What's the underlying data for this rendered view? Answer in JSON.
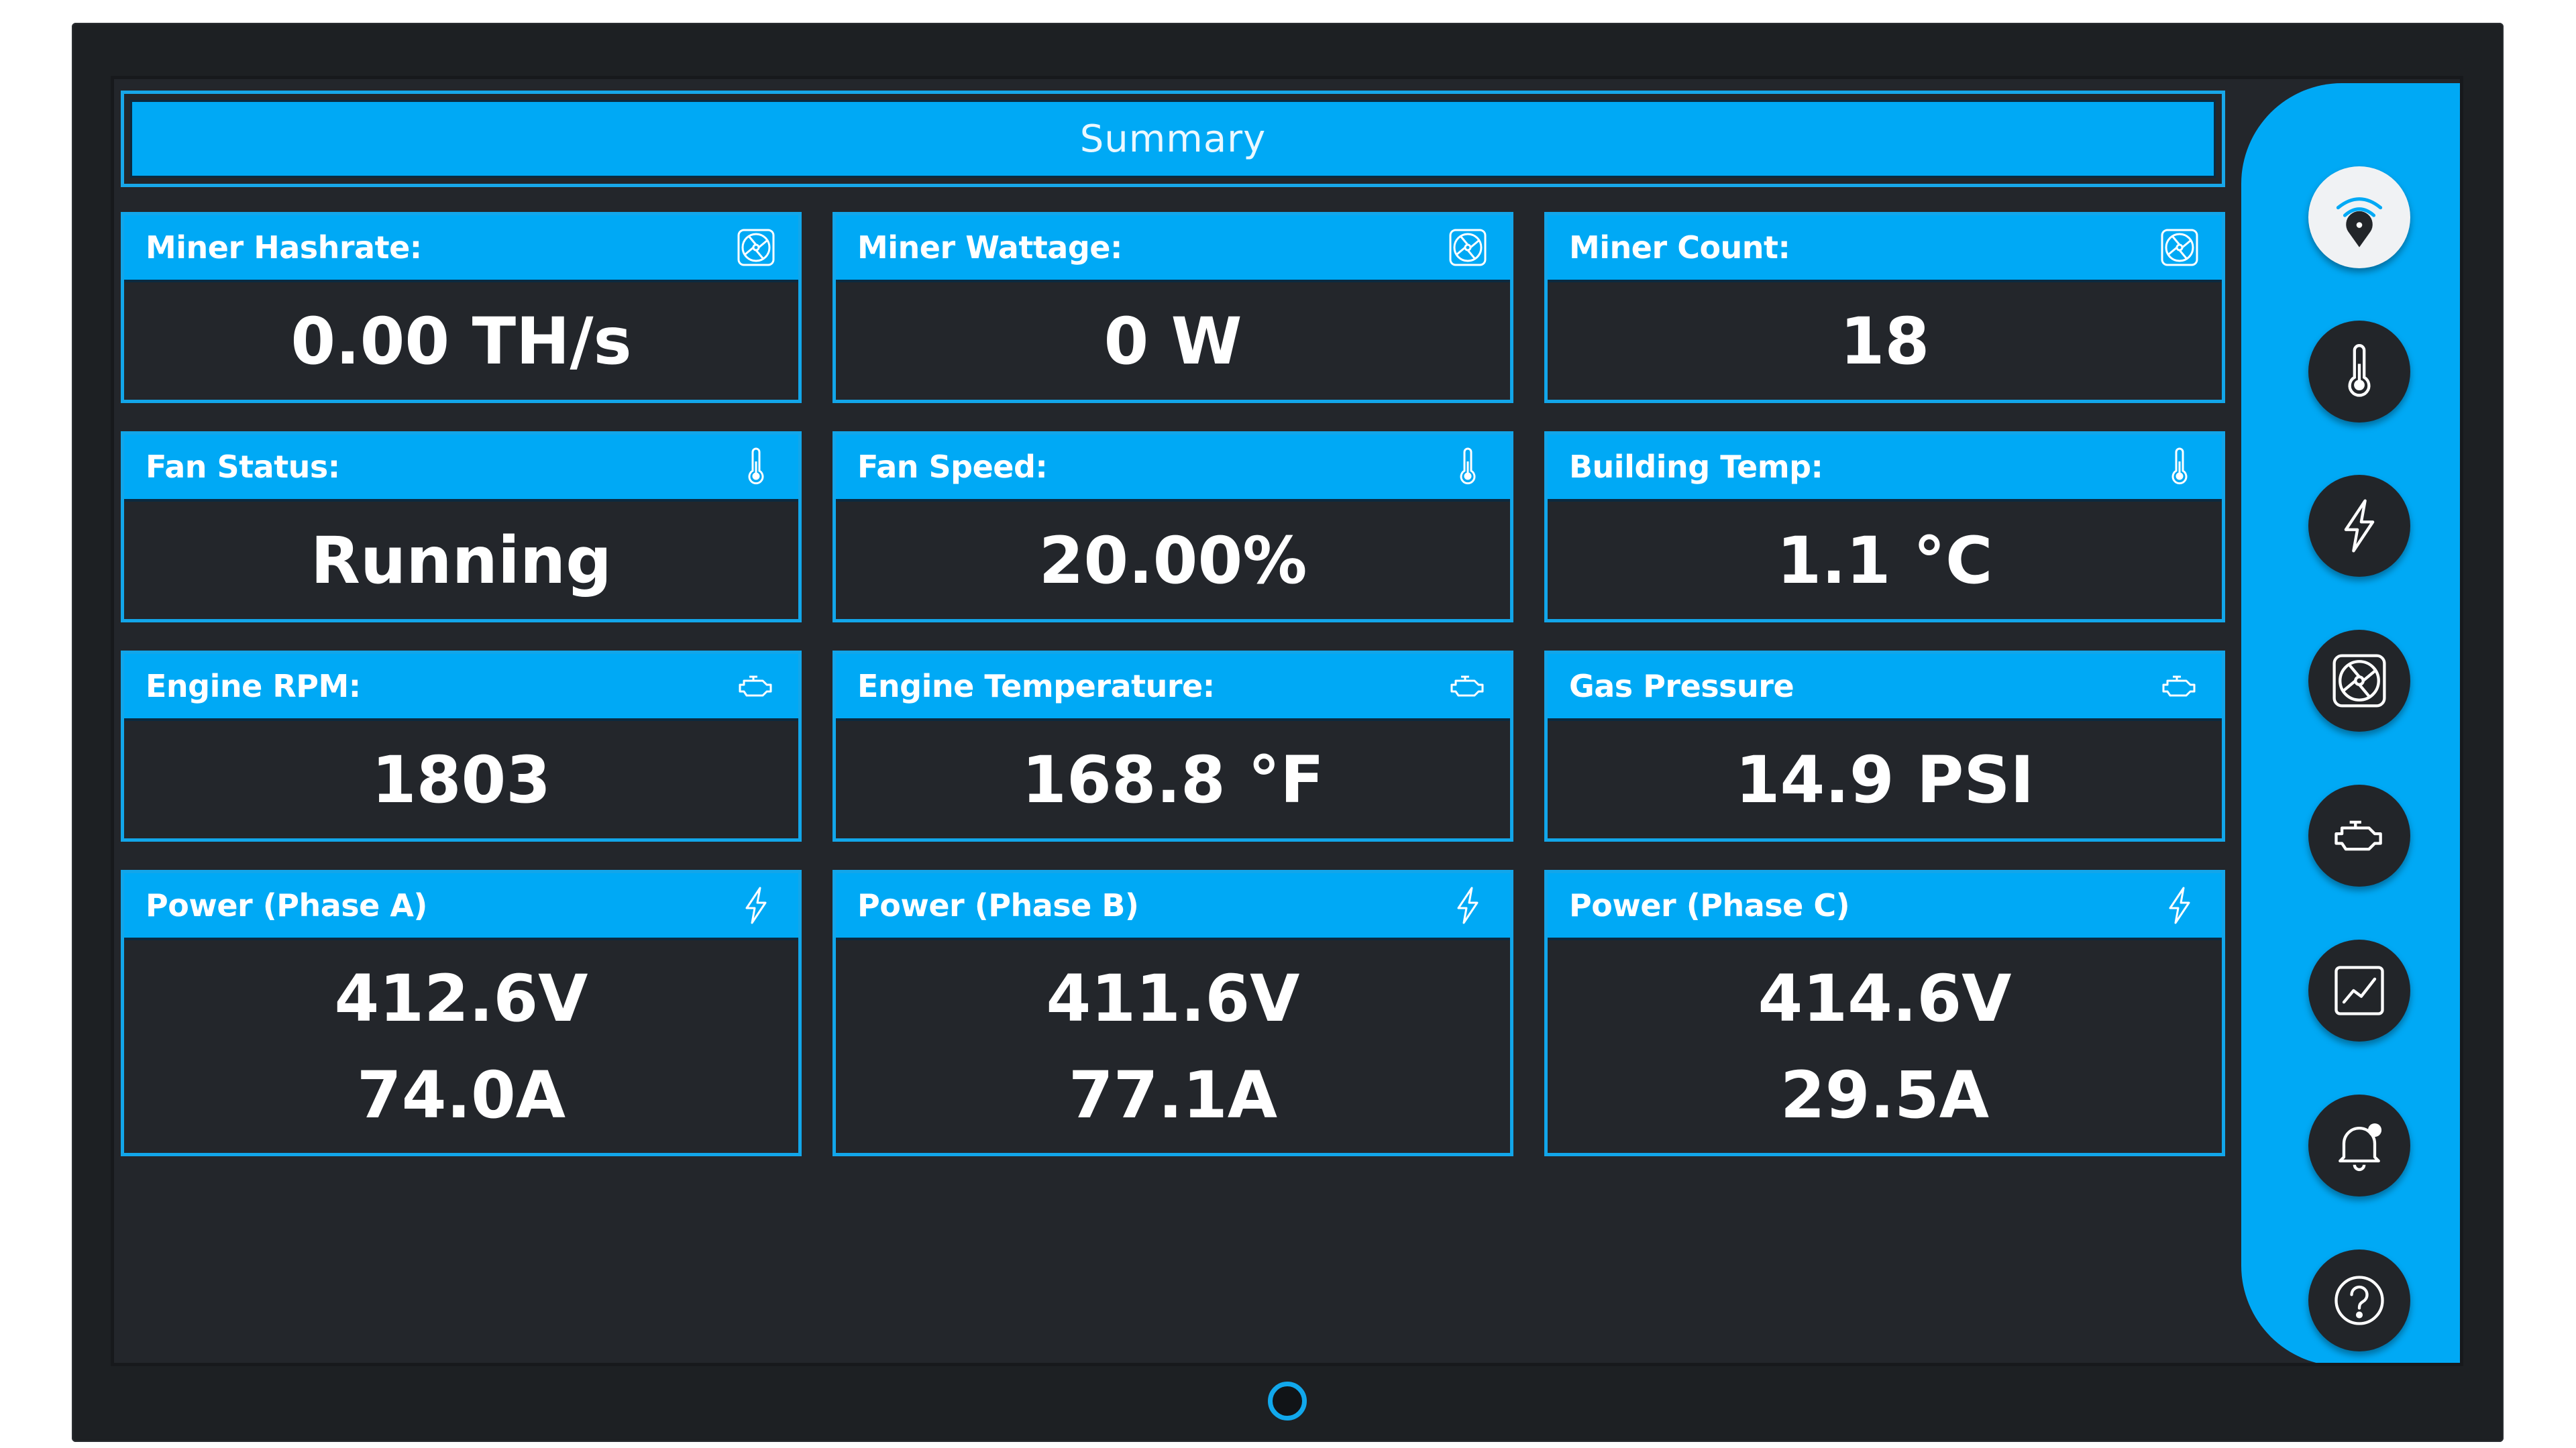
{
  "header": {
    "title": "Summary"
  },
  "cards": [
    {
      "title": "Miner Hashrate:",
      "icon": "miner-fan-icon",
      "lines": [
        "0.00 TH/s"
      ]
    },
    {
      "title": "Miner Wattage:",
      "icon": "miner-fan-icon",
      "lines": [
        "0 W"
      ]
    },
    {
      "title": "Miner Count:",
      "icon": "miner-fan-icon",
      "lines": [
        "18"
      ]
    },
    {
      "title": "Fan Status:",
      "icon": "thermometer-icon",
      "lines": [
        "Running"
      ]
    },
    {
      "title": "Fan Speed:",
      "icon": "thermometer-icon",
      "lines": [
        "20.00%"
      ]
    },
    {
      "title": "Building Temp:",
      "icon": "thermometer-icon",
      "lines": [
        "1.1 °C"
      ]
    },
    {
      "title": "Engine RPM:",
      "icon": "engine-icon",
      "lines": [
        "1803"
      ]
    },
    {
      "title": "Engine Temperature:",
      "icon": "engine-icon",
      "lines": [
        "168.8 °F"
      ]
    },
    {
      "title": "Gas Pressure",
      "icon": "engine-icon",
      "lines": [
        "14.9 PSI"
      ]
    },
    {
      "title": "Power (Phase A)",
      "icon": "lightning-icon",
      "lines": [
        "412.6V",
        "74.0A"
      ]
    },
    {
      "title": "Power (Phase B)",
      "icon": "lightning-icon",
      "lines": [
        "411.6V",
        "77.1A"
      ]
    },
    {
      "title": "Power (Phase C)",
      "icon": "lightning-icon",
      "lines": [
        "414.6V",
        "29.5A"
      ]
    }
  ],
  "sidebar": {
    "items": [
      {
        "icon": "wifi-location-icon",
        "active": true
      },
      {
        "icon": "thermometer-icon",
        "active": false
      },
      {
        "icon": "lightning-icon",
        "active": false
      },
      {
        "icon": "miner-fan-icon",
        "active": false
      },
      {
        "icon": "engine-icon",
        "active": false
      },
      {
        "icon": "chart-icon",
        "active": false
      },
      {
        "icon": "bell-icon",
        "active": false
      },
      {
        "icon": "help-icon",
        "active": false
      }
    ]
  },
  "colors": {
    "accent": "#00a9f5",
    "border": "#12a6ea",
    "panel": "#23262b",
    "text": "#ffffff"
  }
}
